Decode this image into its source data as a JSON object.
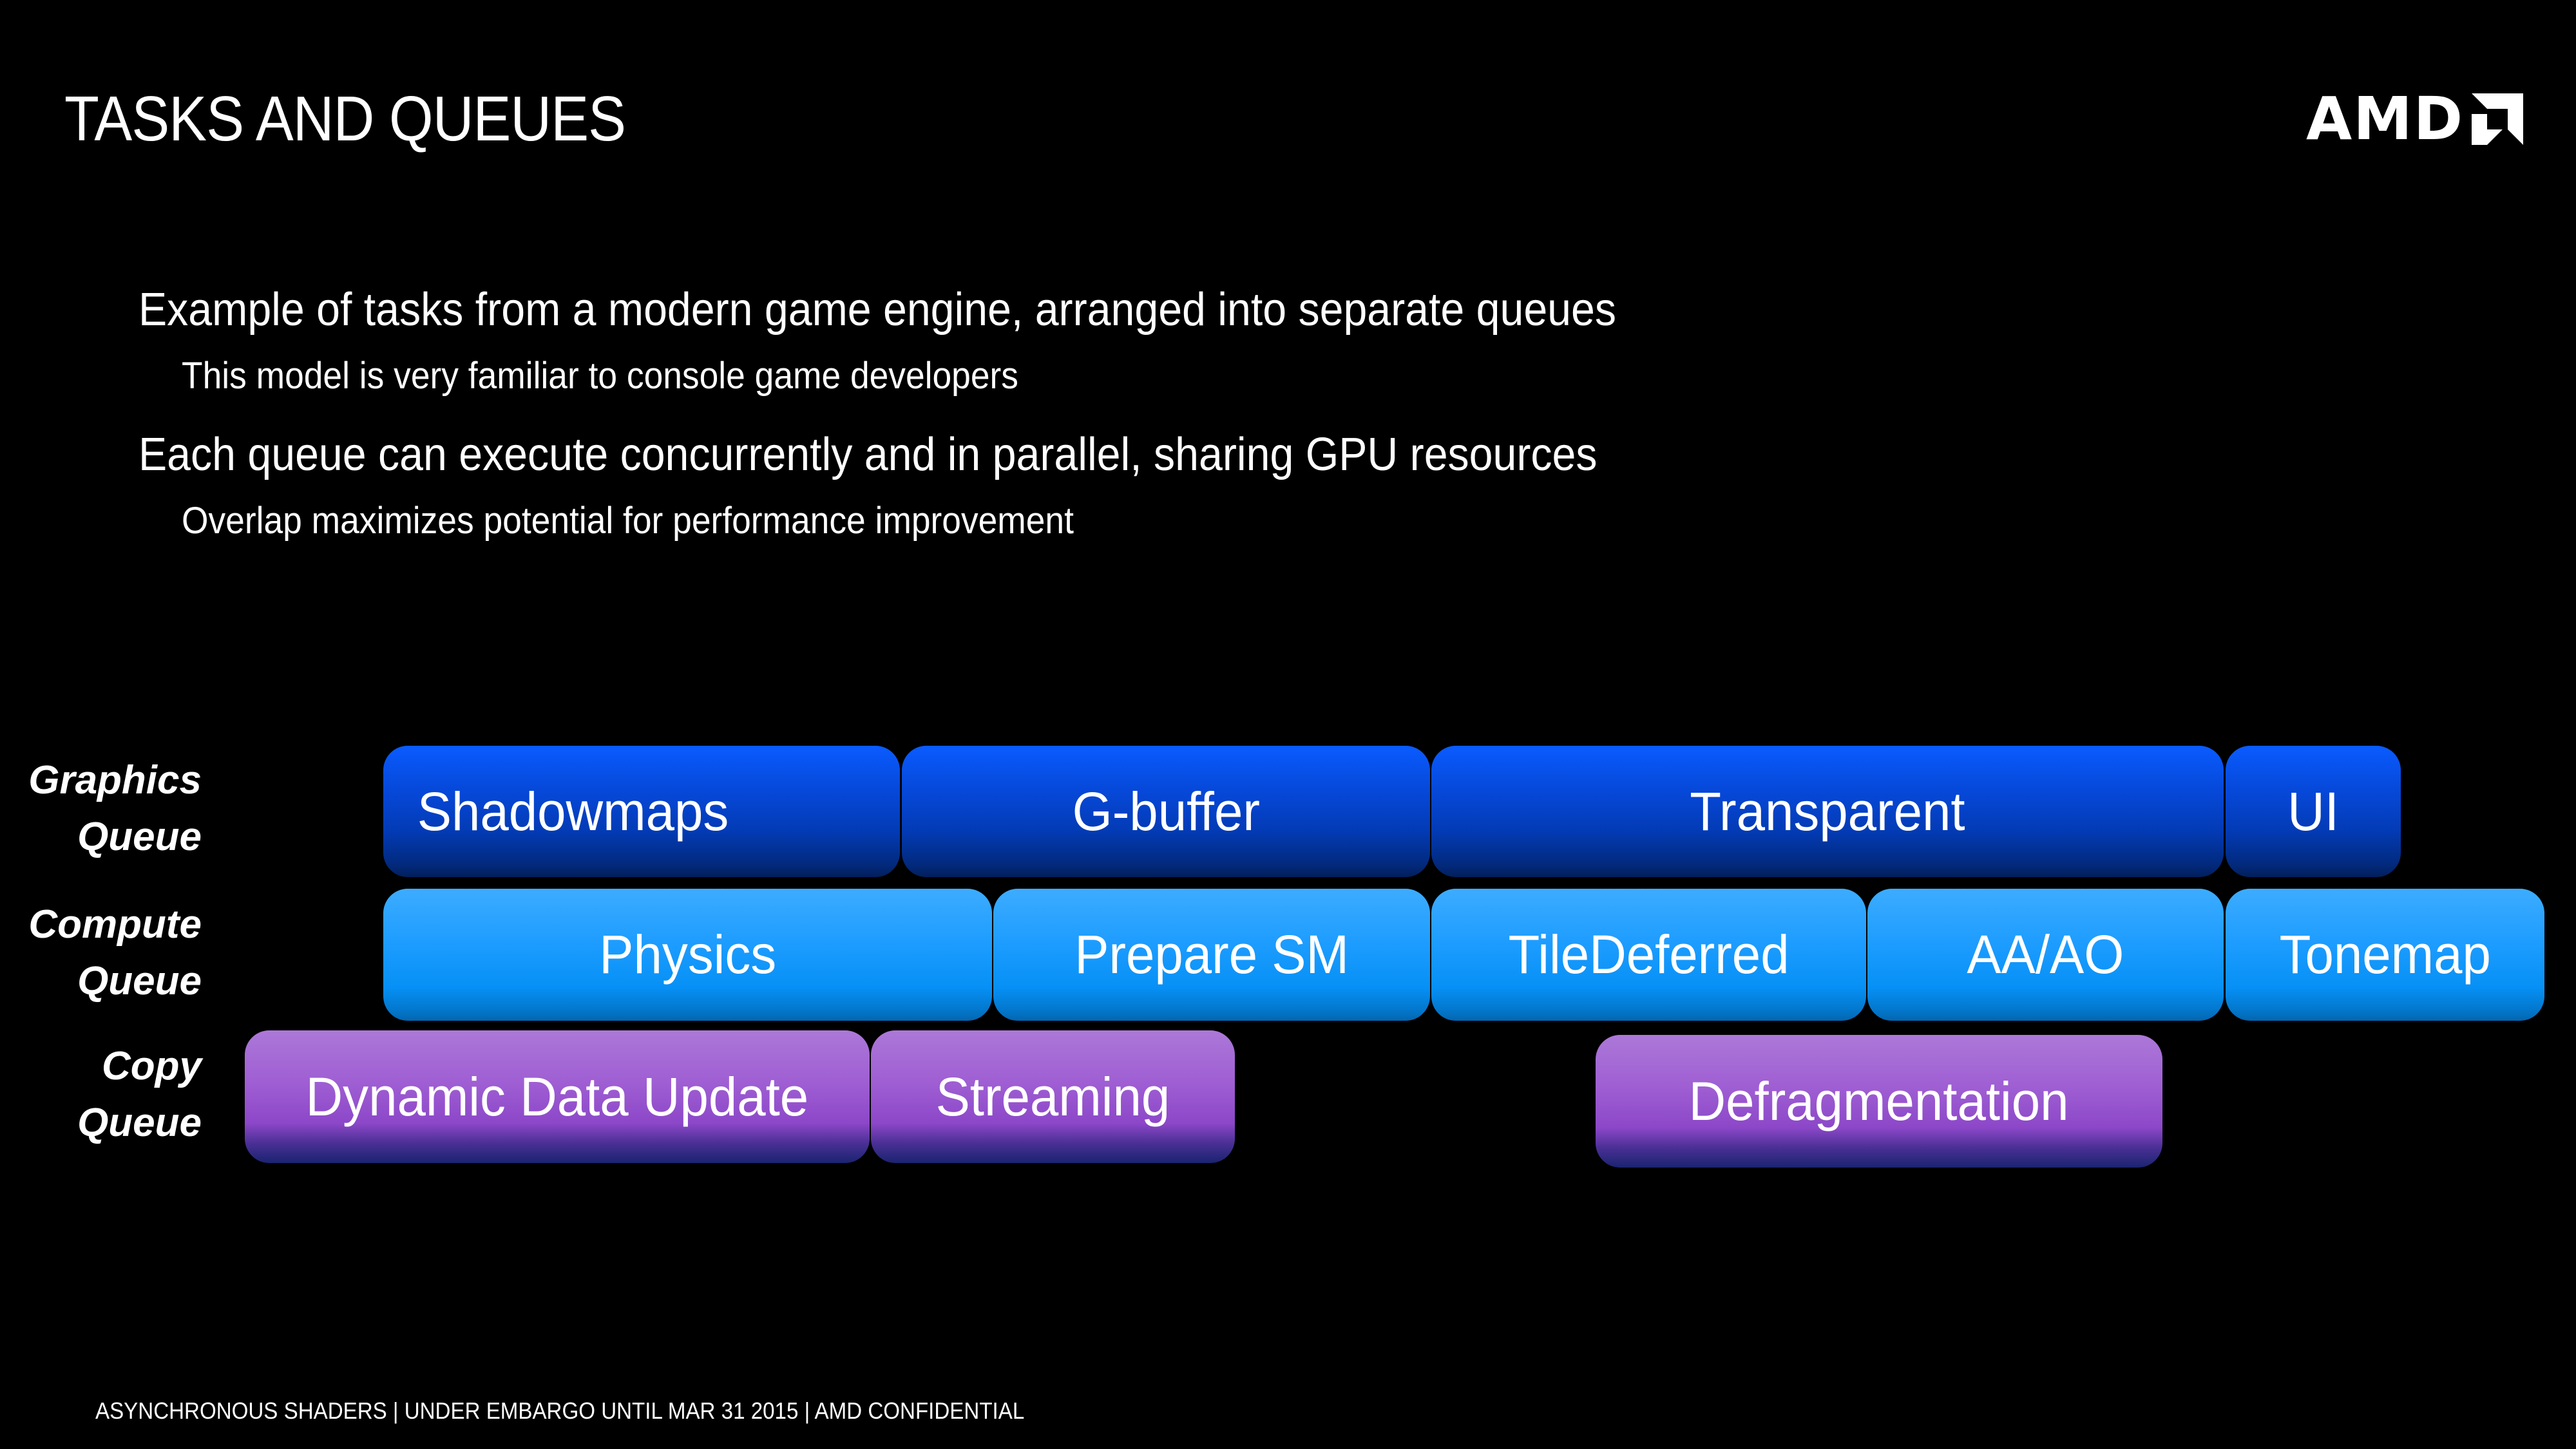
{
  "slide": {
    "title": "TASKS AND QUEUES",
    "logo": {
      "text": "AMD",
      "icon": "amd-arrow-logo-icon"
    },
    "bullets": [
      {
        "level": 1,
        "text": "Example of tasks from a modern game engine, arranged into separate queues"
      },
      {
        "level": 2,
        "text": "This model is very familiar to console game developers"
      },
      {
        "level": 1,
        "text": "Each queue can execute concurrently and in parallel, sharing GPU resources"
      },
      {
        "level": 2,
        "text": "Overlap maximizes potential for performance improvement"
      }
    ],
    "footer": "ASYNCHRONOUS SHADERS | UNDER EMBARGO UNTIL MAR 31 2015 | AMD CONFIDENTIAL"
  },
  "queues": [
    {
      "id": "graphics",
      "label_line1": "Graphics",
      "label_line2": "Queue",
      "color": "#0648d8",
      "tasks": [
        "Shadowmaps",
        "G-buffer",
        "Transparent",
        "UI"
      ]
    },
    {
      "id": "compute",
      "label_line1": "Compute",
      "label_line2": "Queue",
      "color": "#1e9dff",
      "tasks": [
        "Physics",
        "Prepare SM",
        "TileDeferred",
        "AA/AO",
        "Tonemap"
      ]
    },
    {
      "id": "copy",
      "label_line1": "Copy",
      "label_line2": "Queue",
      "color": "#9f5ed3",
      "tasks": [
        "Dynamic Data Update",
        "Streaming",
        "Defragmentation"
      ]
    }
  ]
}
